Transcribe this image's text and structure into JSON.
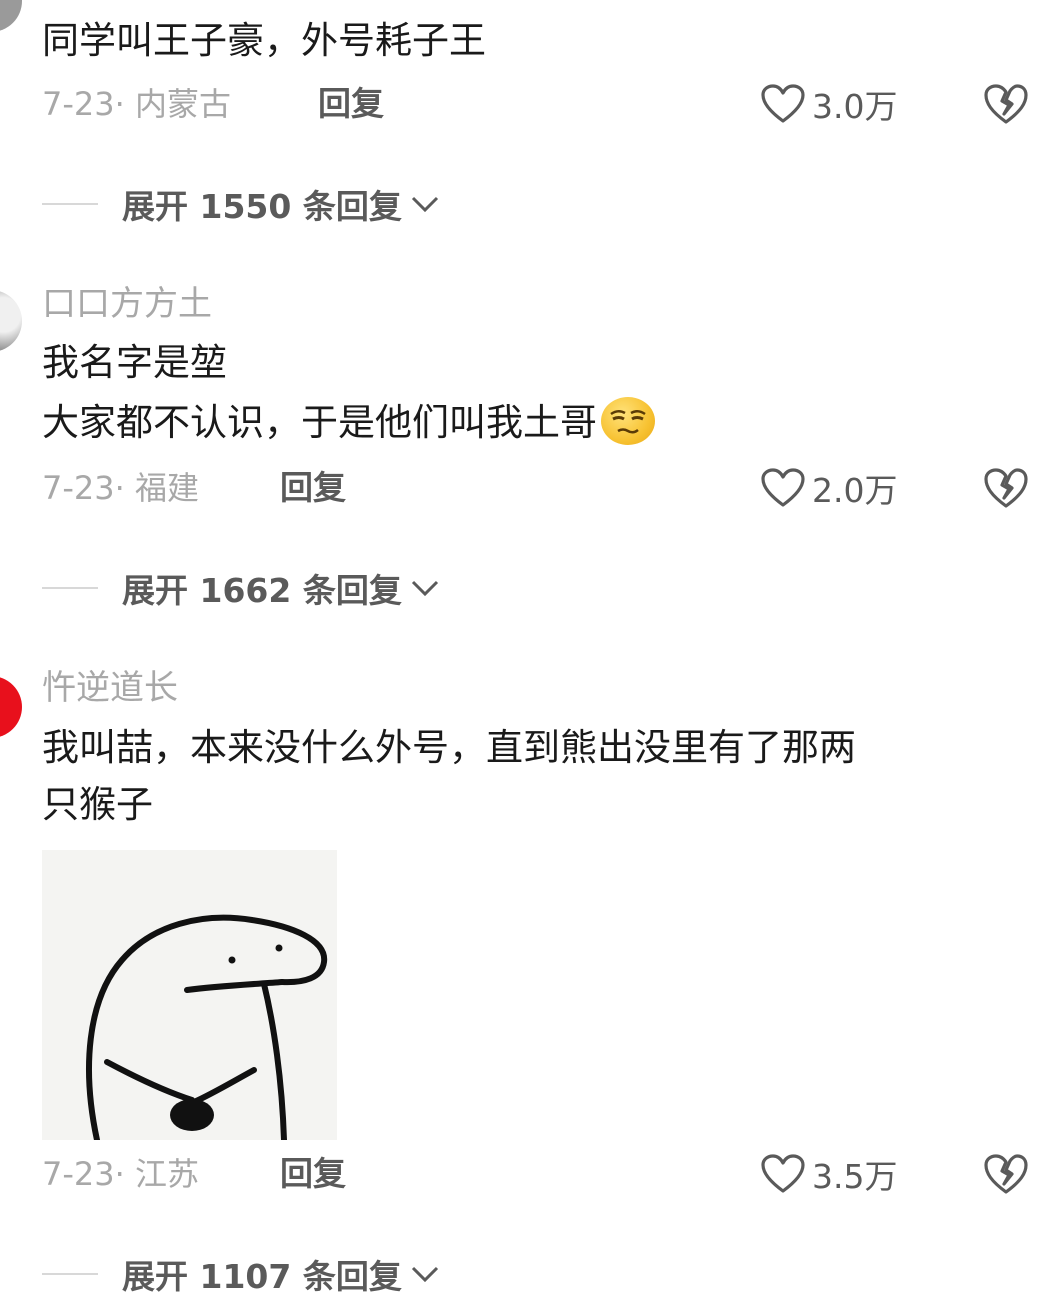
{
  "comments": [
    {
      "avatar_color": "#9a9a9a",
      "text_lines": [
        "同学叫王子豪，外号耗子王"
      ],
      "date_location": "7-23· 内蒙古",
      "reply_label": "回复",
      "likes": "3.0万",
      "expand_label": "展开 1550 条回复"
    },
    {
      "username": "口口方方土",
      "avatar_color": "#8a8a8a",
      "text_lines": [
        "我名字是堃",
        "大家都不认识，于是他们叫我土哥"
      ],
      "emoji": "smirk-face",
      "date_location": "7-23· 福建",
      "reply_label": "回复",
      "likes": "2.0万",
      "expand_label": "展开 1662 条回复"
    },
    {
      "username": "忤逆道长",
      "avatar_color": "#e8101c",
      "text_lines": [
        "我叫喆，本来没什么外号，直到熊出没里有了那两",
        "只猴子"
      ],
      "sticker": "blob-meme-sticker",
      "date_location": "7-23· 江苏",
      "reply_label": "回复",
      "likes": "3.5万",
      "expand_label": "展开 1107 条回复"
    }
  ],
  "icons": {
    "like": "heart-outline-icon",
    "dislike": "broken-heart-icon",
    "expand": "chevron-down-icon"
  }
}
